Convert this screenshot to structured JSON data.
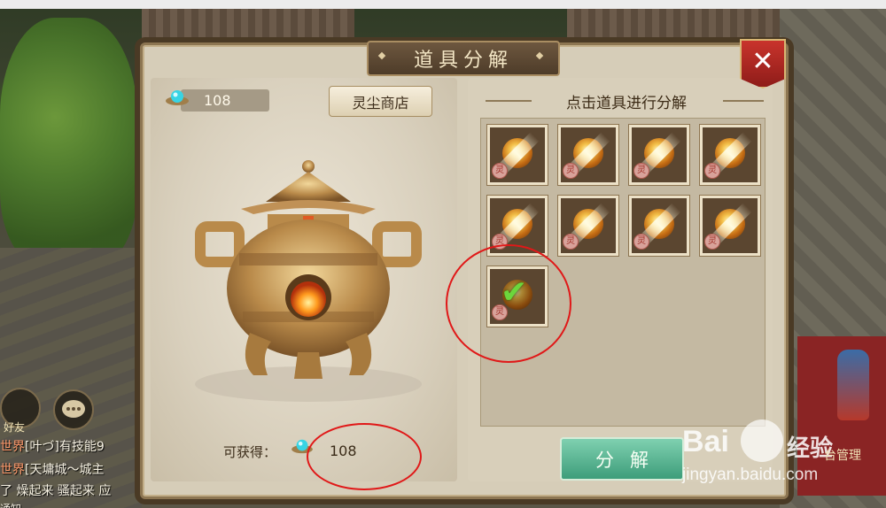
{
  "dialog": {
    "title": "道具分解",
    "close_icon": "close-icon"
  },
  "left_panel": {
    "currency_value": "108",
    "currency_icon": "soul-dust-gem-icon",
    "shop_button": "灵尘商店",
    "gain_label": "可获得：",
    "gain_value": "108"
  },
  "right_panel": {
    "instruction": "点击道具进行分解",
    "slots": [
      {
        "item": "gold-orb",
        "selected": false,
        "seal": "灵"
      },
      {
        "item": "gold-orb",
        "selected": false,
        "seal": "灵"
      },
      {
        "item": "gold-orb",
        "selected": false,
        "seal": "灵"
      },
      {
        "item": "gold-orb",
        "selected": false,
        "seal": "灵"
      },
      {
        "item": "gold-orb",
        "selected": false,
        "seal": "灵"
      },
      {
        "item": "gold-orb",
        "selected": false,
        "seal": "灵"
      },
      {
        "item": "gold-orb",
        "selected": false,
        "seal": "灵"
      },
      {
        "item": "gold-orb",
        "selected": false,
        "seal": "灵"
      },
      {
        "item": "gold-orb",
        "selected": true,
        "seal": "灵"
      }
    ],
    "decompose_button": "分解"
  },
  "chat": {
    "friend_label": "好友",
    "lines": [
      {
        "tag": "世界",
        "text": "[叶づ]有技能9"
      },
      {
        "tag": "世界",
        "text": "[天墉城～城主"
      },
      {
        "tag": "",
        "text": "了  燥起来  骚起来 应"
      },
      {
        "tag": "",
        "text": "通知"
      }
    ]
  },
  "watermark": {
    "logo_text": "Bai",
    "logo_text_2": "经验",
    "url": "jingyan.baidu.com",
    "tail_text": "台管理"
  },
  "colors": {
    "dialog_bg": "#d6cdb8",
    "title_plate": "#5a4632",
    "close_red": "#b82a24",
    "decompose_green": "#4fae89",
    "annotation_red": "#e01818"
  }
}
